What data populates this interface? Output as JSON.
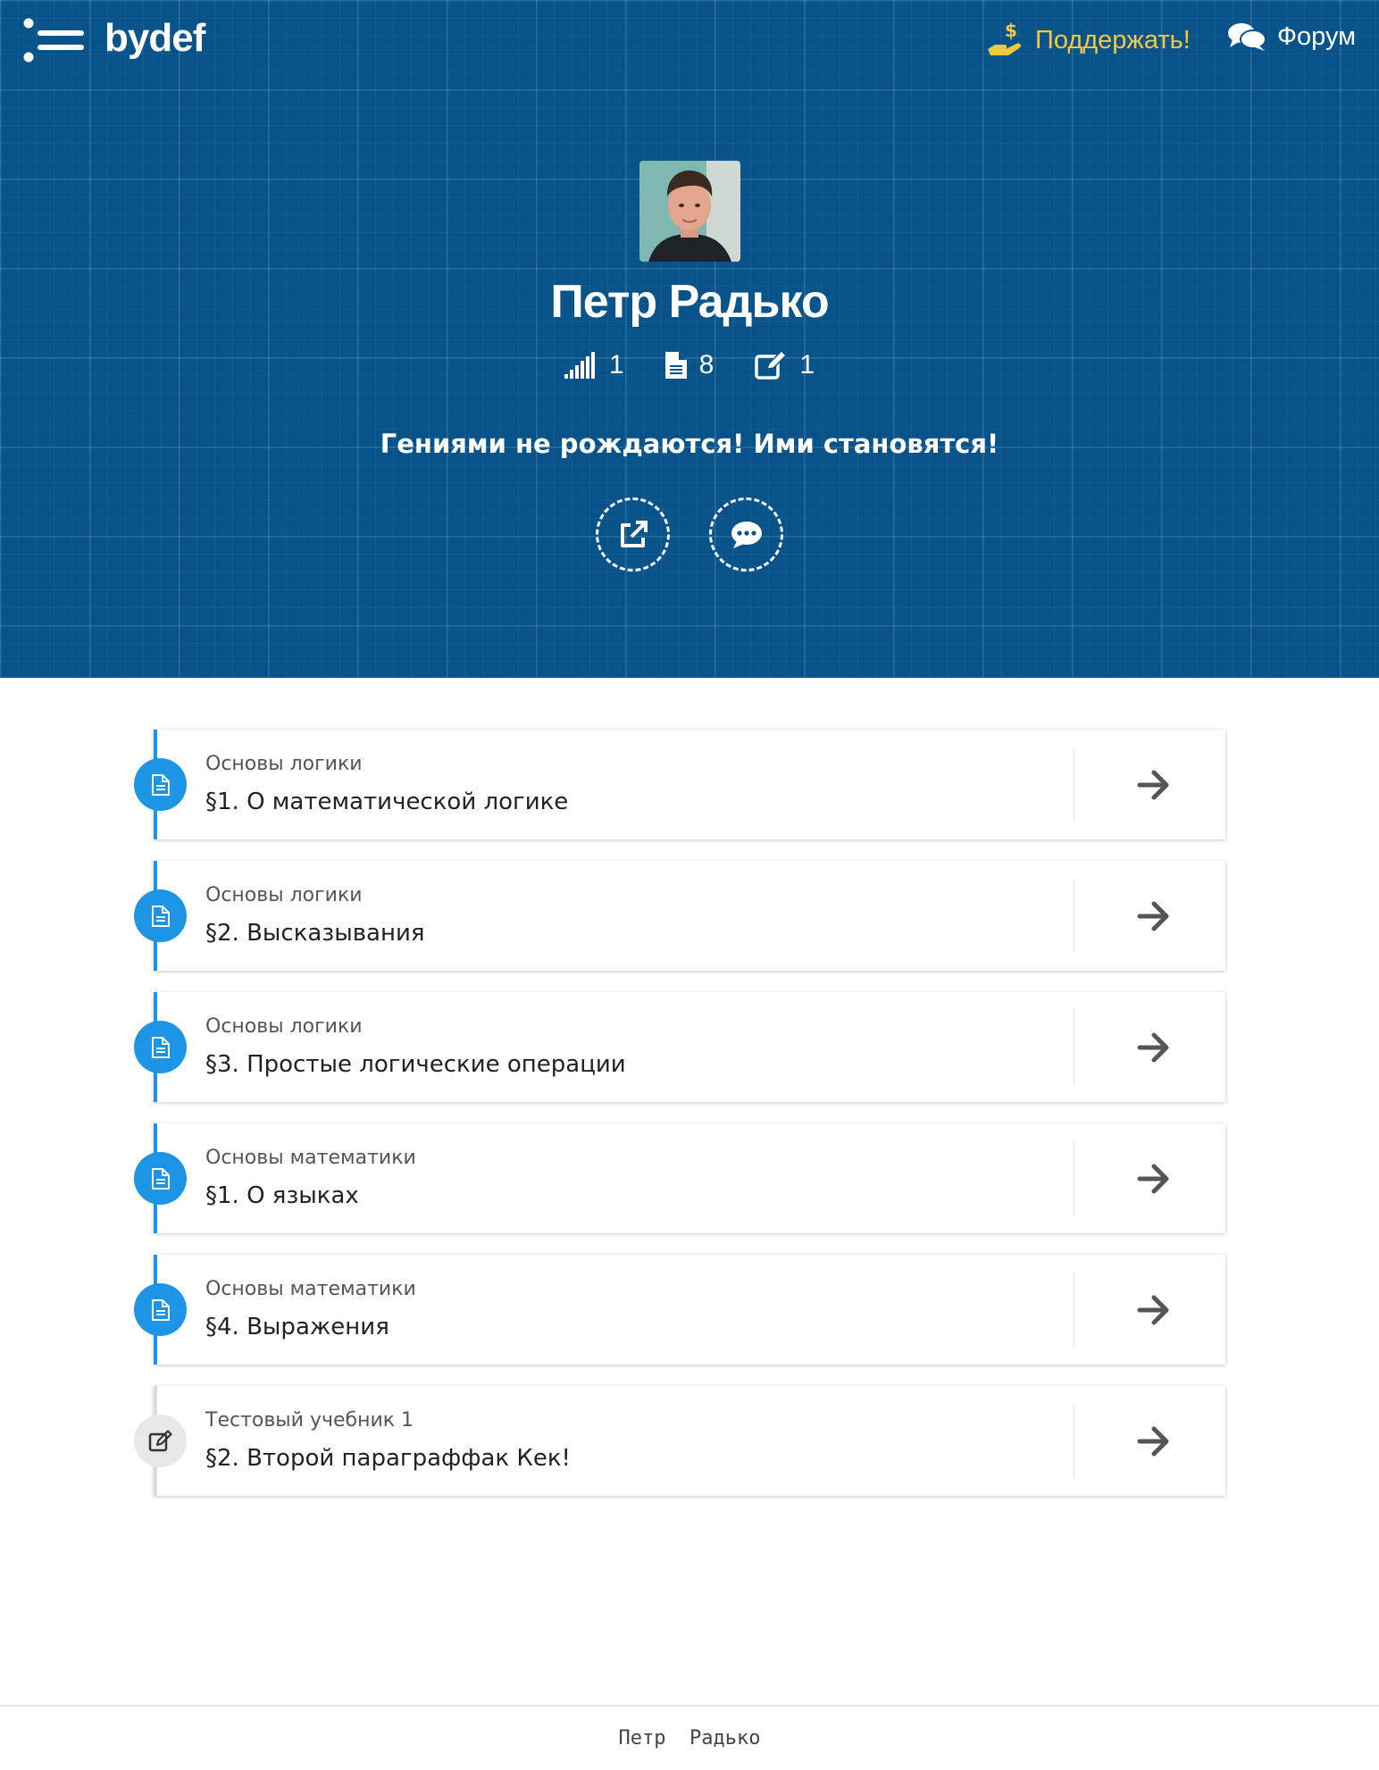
{
  "header": {
    "logo": "bydef",
    "support_label": "Поддержать!",
    "forum_label": "Форум"
  },
  "profile": {
    "name": "Петр Радько",
    "stats": [
      {
        "icon": "signal-bars-icon",
        "value": "1"
      },
      {
        "icon": "document-icon",
        "value": "8"
      },
      {
        "icon": "edit-icon",
        "value": "1"
      }
    ],
    "motto": "Гениями не рождаются! Ими становятся!",
    "actions": [
      {
        "icon": "external-link-icon"
      },
      {
        "icon": "chat-bubble-icon"
      }
    ]
  },
  "items": [
    {
      "subtitle": "Основы логики",
      "title": "§1. О математической логике",
      "icon": "document-icon",
      "color": "#1e95e4"
    },
    {
      "subtitle": "Основы логики",
      "title": "§2. Высказывания",
      "icon": "document-icon",
      "color": "#1e95e4"
    },
    {
      "subtitle": "Основы логики",
      "title": "§3. Простые логические операции",
      "icon": "document-icon",
      "color": "#1e95e4"
    },
    {
      "subtitle": "Основы математики",
      "title": "§1. О языках",
      "icon": "document-icon",
      "color": "#1e95e4"
    },
    {
      "subtitle": "Основы математики",
      "title": "§4. Выражения",
      "icon": "document-icon",
      "color": "#1e95e4"
    },
    {
      "subtitle": "Тестовый учебник 1",
      "title": "§2. Второй параграффак Кек!",
      "icon": "edit-icon",
      "color": "#e8e8e8"
    }
  ],
  "footer": {
    "text": "Петр  Радько"
  },
  "colors": {
    "header_bg": "#07538a",
    "accent": "#1e95e4",
    "support": "#f5c842"
  }
}
